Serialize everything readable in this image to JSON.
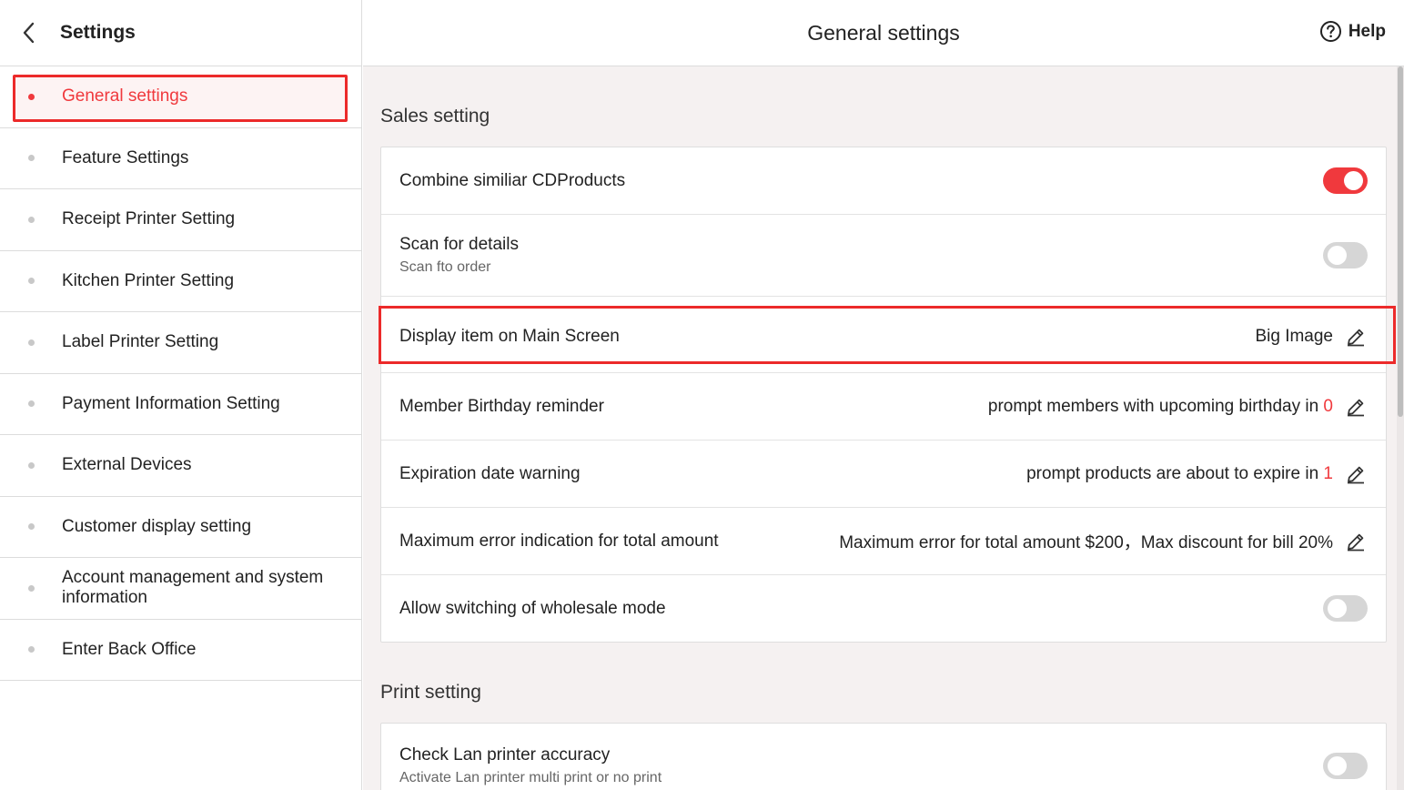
{
  "sidebar": {
    "title": "Settings",
    "items": [
      {
        "label": "General settings"
      },
      {
        "label": "Feature Settings"
      },
      {
        "label": "Receipt Printer Setting"
      },
      {
        "label": "Kitchen Printer Setting"
      },
      {
        "label": "Label Printer Setting"
      },
      {
        "label": "Payment Information Setting"
      },
      {
        "label": "External Devices"
      },
      {
        "label": "Customer display setting"
      },
      {
        "label": "Account management and system information"
      },
      {
        "label": "Enter Back Office"
      }
    ]
  },
  "header": {
    "title": "General settings",
    "help_label": "Help"
  },
  "sales": {
    "title": "Sales setting",
    "combine": {
      "label": "Combine similiar CDProducts",
      "enabled": true
    },
    "scan": {
      "label": "Scan for details",
      "sub": "Scan fto order",
      "enabled": false
    },
    "display": {
      "label": "Display item on Main Screen",
      "value": "Big Image"
    },
    "birthday": {
      "label": "Member Birthday reminder",
      "value": "prompt members with upcoming birthday in ",
      "num": "0"
    },
    "expiration": {
      "label": "Expiration date warning",
      "value": "prompt products are about to expire in ",
      "num": "1"
    },
    "max_error": {
      "label": "Maximum error indication for total amount",
      "value": "Maximum error for total amount $200，Max discount for bill 20%"
    },
    "wholesale": {
      "label": "Allow switching of wholesale mode",
      "enabled": false
    }
  },
  "print": {
    "title": "Print setting",
    "lan_check": {
      "label": "Check Lan printer accuracy",
      "sub": "Activate Lan printer multi print or no print",
      "enabled": false
    }
  },
  "colors": {
    "accent": "#f0393d",
    "highlight_border": "#ec2a2a"
  }
}
